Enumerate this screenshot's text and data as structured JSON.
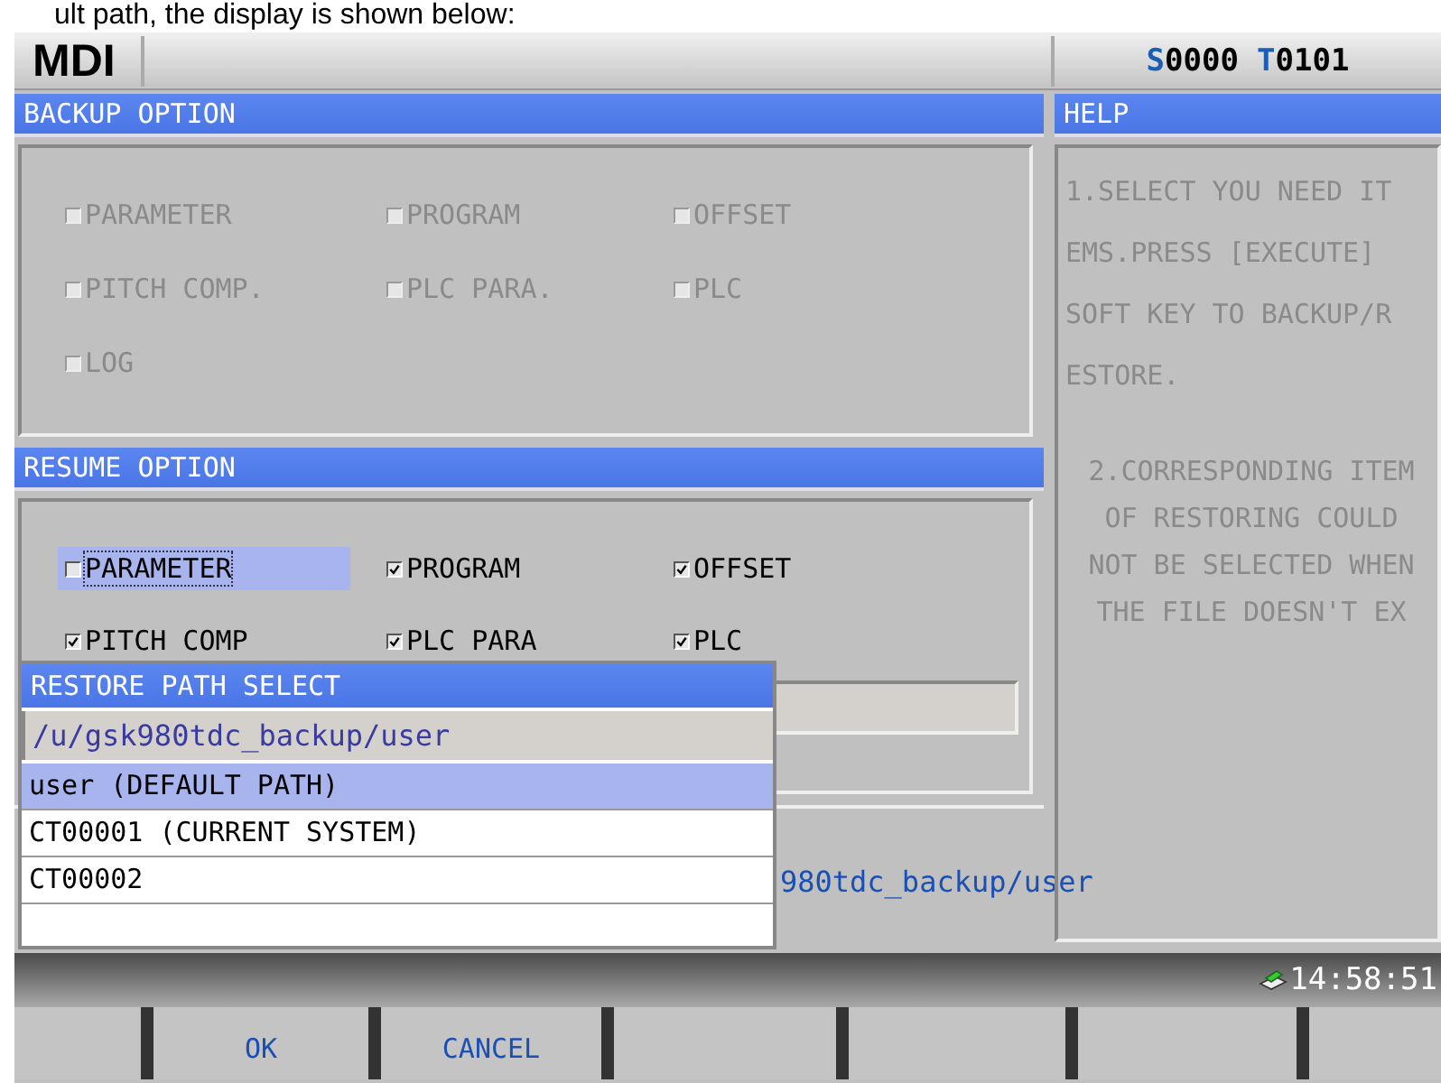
{
  "document_caption": "ult path, the display is shown below:",
  "header": {
    "mode": "MDI",
    "spindle": {
      "letter": "S",
      "value": "0000"
    },
    "tool": {
      "letter": "T",
      "value": "0101"
    }
  },
  "backup": {
    "title": "BACKUP OPTION",
    "items": [
      {
        "label": "PARAMETER",
        "checked": false,
        "disabled": true,
        "selected": false
      },
      {
        "label": "PROGRAM",
        "checked": false,
        "disabled": true,
        "selected": false
      },
      {
        "label": "OFFSET",
        "checked": false,
        "disabled": true,
        "selected": false
      },
      {
        "label": "PITCH COMP.",
        "checked": false,
        "disabled": true,
        "selected": false
      },
      {
        "label": "PLC PARA.",
        "checked": false,
        "disabled": true,
        "selected": false
      },
      {
        "label": "PLC",
        "checked": false,
        "disabled": true,
        "selected": false
      },
      {
        "label": "LOG",
        "checked": false,
        "disabled": true,
        "selected": false
      }
    ]
  },
  "resume": {
    "title": "RESUME OPTION",
    "items": [
      {
        "label": "PARAMETER",
        "checked": false,
        "disabled": false,
        "selected": true
      },
      {
        "label": "PROGRAM",
        "checked": true,
        "disabled": false,
        "selected": false
      },
      {
        "label": "OFFSET",
        "checked": true,
        "disabled": false,
        "selected": false
      },
      {
        "label": "PITCH COMP",
        "checked": true,
        "disabled": false,
        "selected": false
      },
      {
        "label": "PLC PARA",
        "checked": true,
        "disabled": false,
        "selected": false
      },
      {
        "label": "PLC",
        "checked": true,
        "disabled": false,
        "selected": false
      }
    ]
  },
  "help": {
    "title": "HELP",
    "paragraphs": [
      {
        "lines": [
          "1.SELECT YOU NEED IT",
          "EMS.PRESS [EXECUTE]",
          "SOFT KEY TO BACKUP/R",
          "ESTORE."
        ]
      },
      {
        "lines": [
          "2.CORRESPONDING ITEM",
          "OF RESTORING COULD",
          "NOT BE SELECTED WHEN",
          "THE FILE DOESN'T EX"
        ]
      }
    ]
  },
  "restore_path": "980tdc_backup/user",
  "dialog": {
    "title": "RESTORE PATH SELECT",
    "path": "/u/gsk980tdc_backup/user",
    "items": [
      {
        "label": "user (DEFAULT PATH)",
        "selected": true
      },
      {
        "label": "CT00001 (CURRENT SYSTEM)",
        "selected": false
      },
      {
        "label": "CT00002",
        "selected": false
      }
    ]
  },
  "status_bar": {
    "time": "14:58:51"
  },
  "softkeys": [
    {
      "kind": "blank"
    },
    {
      "kind": "label",
      "label": "OK"
    },
    {
      "kind": "label",
      "label": "CANCEL"
    },
    {
      "kind": "blank"
    },
    {
      "kind": "blank"
    },
    {
      "kind": "blank"
    },
    {
      "kind": "blank"
    }
  ]
}
